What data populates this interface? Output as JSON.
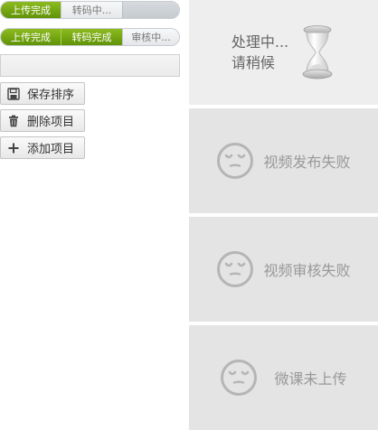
{
  "progress_bars": [
    {
      "steps": [
        {
          "label": "上传完成",
          "state": "done"
        },
        {
          "label": "转码中...",
          "state": "pending"
        },
        {
          "label": "",
          "state": "blank"
        }
      ]
    },
    {
      "steps": [
        {
          "label": "上传完成",
          "state": "done"
        },
        {
          "label": "转码完成",
          "state": "done"
        },
        {
          "label": "审核中...",
          "state": "pending"
        }
      ]
    }
  ],
  "title_input": {
    "value": "",
    "placeholder": ""
  },
  "buttons": {
    "save": {
      "label": "保存排序",
      "icon": "save-icon"
    },
    "delete": {
      "label": "删除项目",
      "icon": "trash-icon"
    },
    "add": {
      "label": "添加项目",
      "icon": "plus-icon"
    }
  },
  "cards": [
    {
      "lines": [
        "处理中...",
        "请稍候"
      ],
      "icon": "hourglass-icon"
    },
    {
      "text": "视频发布失败",
      "icon": "sad-face-icon"
    },
    {
      "text": "视频审核失败",
      "icon": "sad-face-icon"
    },
    {
      "text": "微课未上传",
      "icon": "sad-face-icon"
    }
  ],
  "colors": {
    "done_green": "#6fa00f",
    "card_gray": "#e4e4e4",
    "card_processing": "#eeeeee",
    "status_text": "#999999"
  }
}
